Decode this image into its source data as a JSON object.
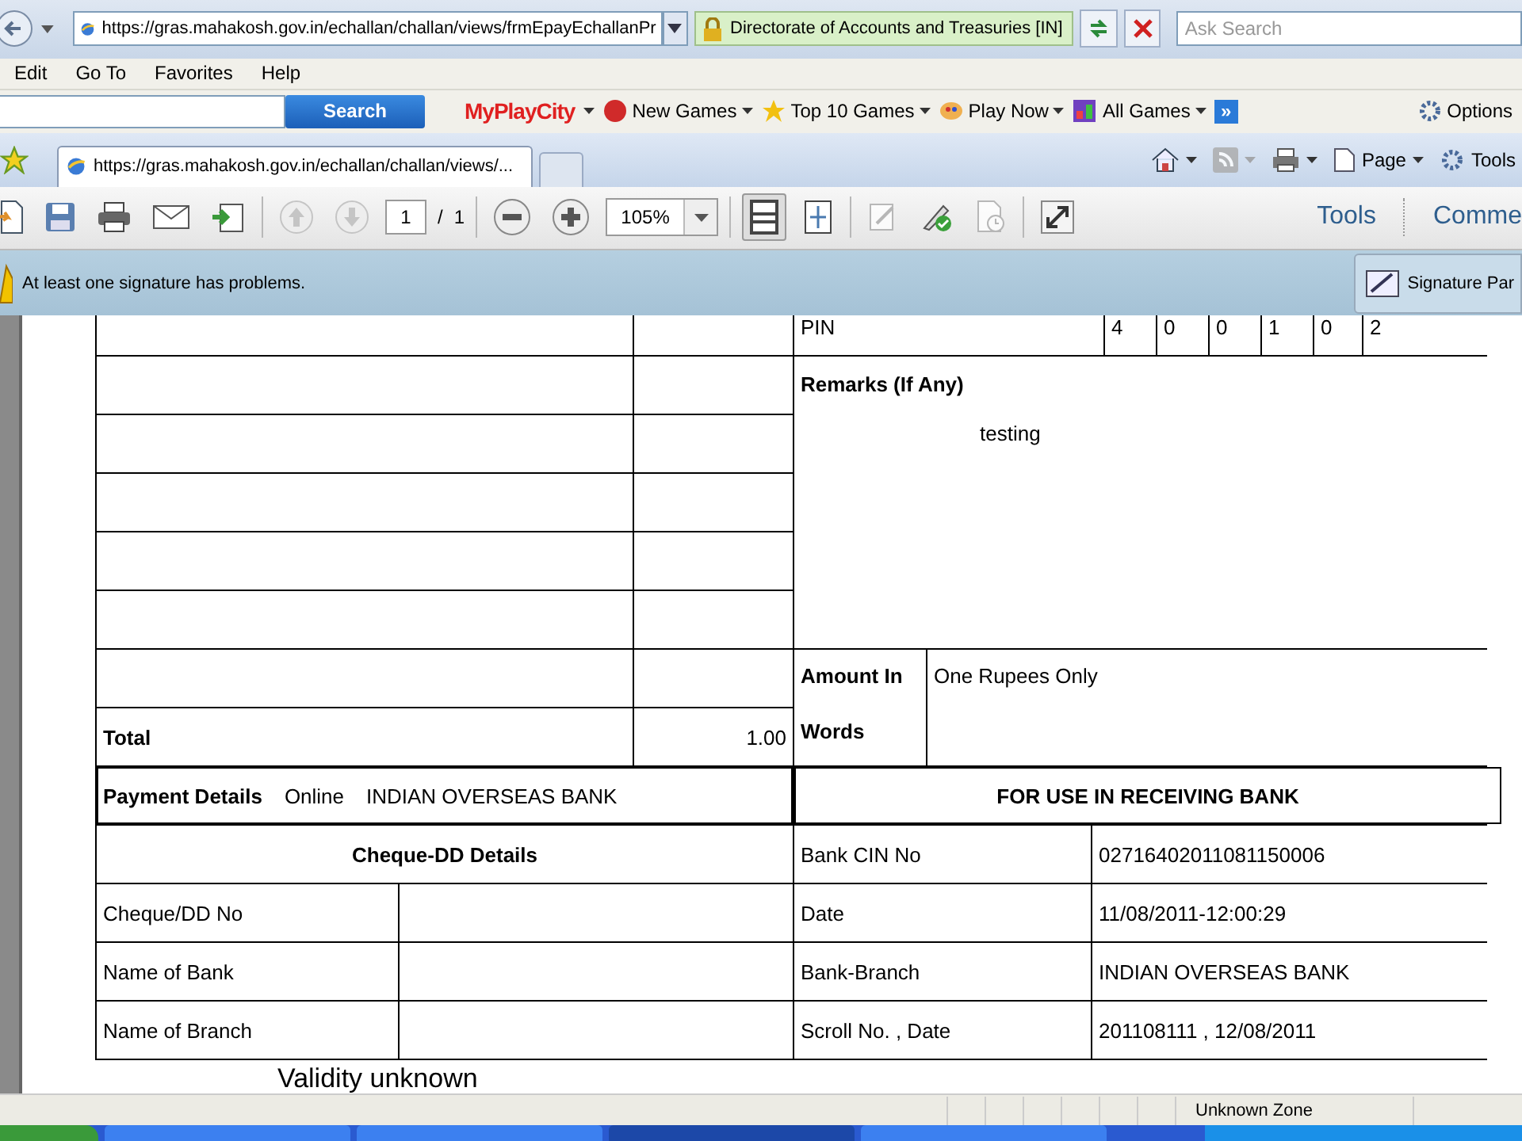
{
  "address_bar": {
    "url": "https://gras.mahakosh.gov.in/echallan/challan/views/frmEpayEchallanPr",
    "site_label": "Directorate of Accounts and Treasuries [IN]",
    "search_placeholder": "Ask Search"
  },
  "menu_bar": [
    "Edit",
    "Go To",
    "Favorites",
    "Help"
  ],
  "ask_toolbar": {
    "search_button": "Search",
    "logo": "MyPlayCity",
    "items": [
      {
        "label": "New Games",
        "kind": "ball"
      },
      {
        "label": "Top 10 Games",
        "kind": "star"
      },
      {
        "label": "Play Now",
        "kind": "palette"
      },
      {
        "label": "All Games",
        "kind": "grid"
      }
    ],
    "more": "»",
    "options": "Options"
  },
  "tab_bar": {
    "tabs": [
      {
        "title": "https://gras.mahakosh.gov.in/echallan/challan/views/...",
        "selected": true
      }
    ],
    "commands": [
      {
        "kind": "home"
      },
      {
        "kind": "feed"
      },
      {
        "kind": "print"
      },
      {
        "kind": "page",
        "label": "Page"
      },
      {
        "kind": "tools",
        "label": "Tools"
      }
    ]
  },
  "pdf_toolbar": {
    "page": "1",
    "separator": "/",
    "page_count": "1",
    "zoom": "105%",
    "tools": "Tools",
    "comment": "Comme"
  },
  "signature_bar": {
    "message": "At least one signature has problems.",
    "panel_button": "Signature Par"
  },
  "document": {
    "pin": {
      "label": "PIN",
      "digits": [
        "4",
        "0",
        "0",
        "1",
        "0",
        "2"
      ]
    },
    "remarks": {
      "label": "Remarks (If Any)",
      "value": "testing"
    },
    "total": {
      "label": "Total",
      "amount": "1.00"
    },
    "amount_in_words": {
      "label_lines": [
        "Amount In",
        "Words"
      ],
      "value": "One Rupees Only"
    },
    "payment_details": {
      "label": "Payment Details",
      "mode": "Online",
      "bank": "INDIAN OVERSEAS BANK"
    },
    "receiving_bank_heading": "FOR USE IN RECEIVING BANK",
    "cheque_dd": {
      "heading": "Cheque-DD Details",
      "rows": [
        "Cheque/DD No",
        "Name of Bank",
        "Name of Branch"
      ]
    },
    "bank_rows": [
      {
        "label": "Bank CIN No",
        "value": "02716402011081150006"
      },
      {
        "label": "Date",
        "value": "11/08/2011-12:00:29"
      },
      {
        "label": "Bank-Branch",
        "value": "INDIAN OVERSEAS BANK"
      },
      {
        "label": "Scroll No. , Date",
        "value": "201108111 , 12/08/2011"
      }
    ],
    "validity": "Validity unknown"
  },
  "status_bar": {
    "zone": "Unknown Zone"
  }
}
